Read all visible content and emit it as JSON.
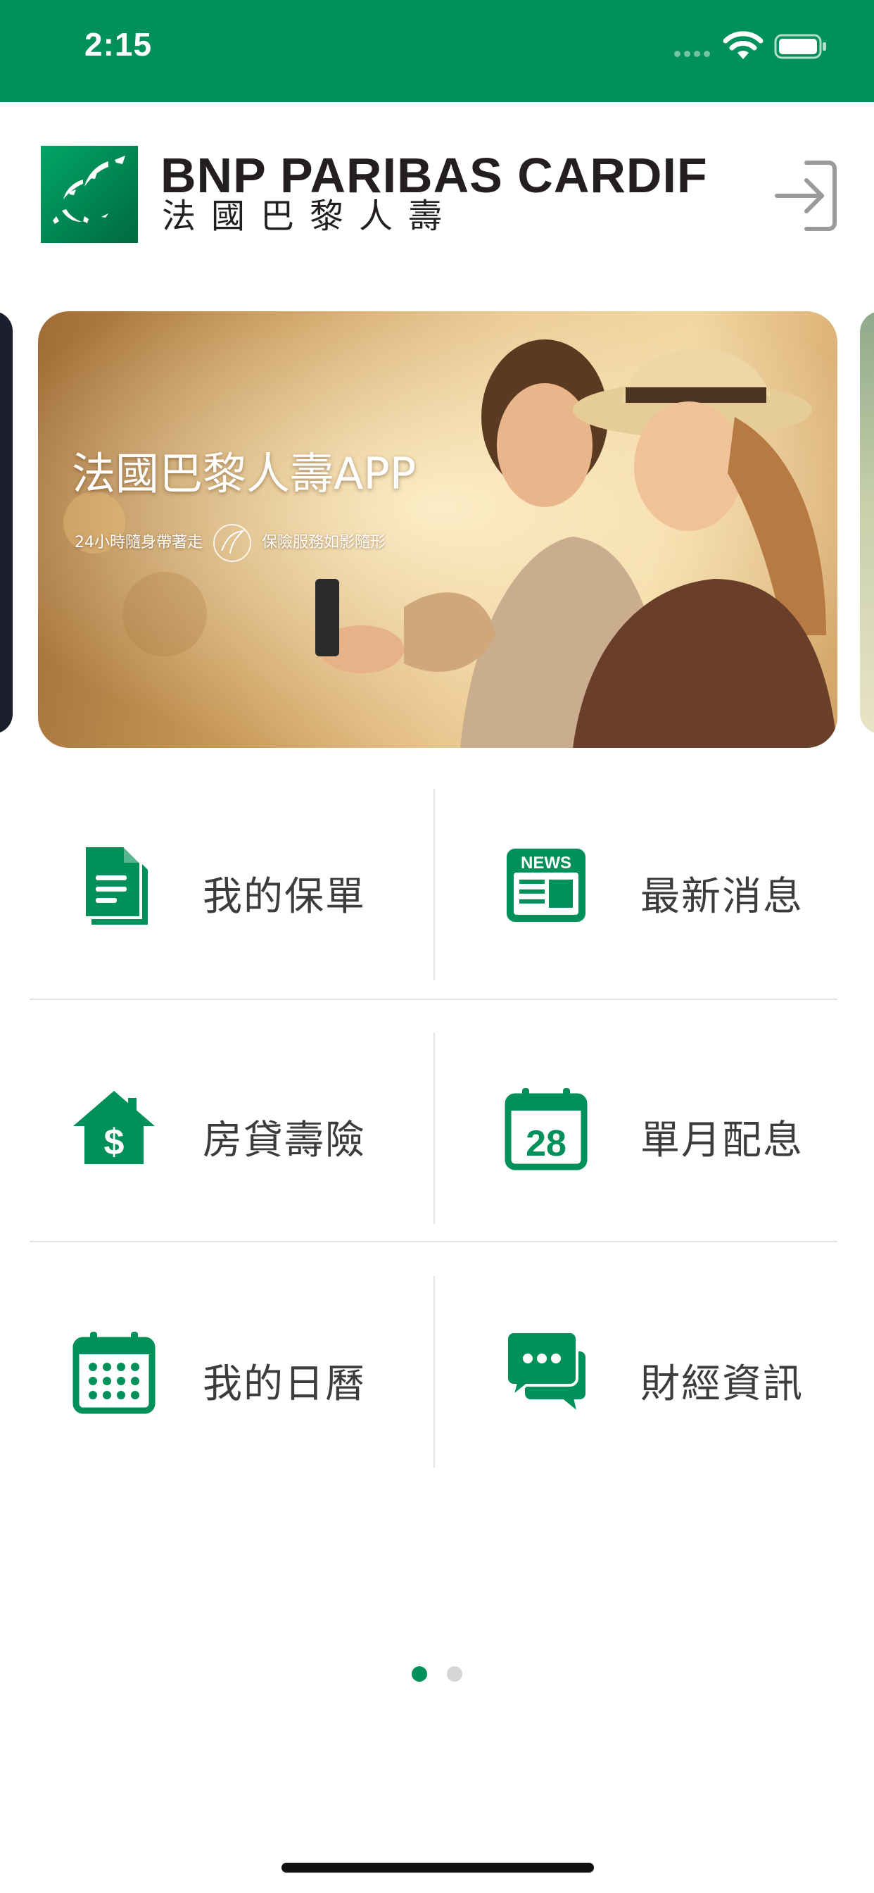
{
  "status_bar": {
    "time": "2:15",
    "background_color": "#00905a"
  },
  "header": {
    "brand_en": "BNP PARIBAS CARDIF",
    "brand_zh": "法國巴黎人壽",
    "login_icon": "login-arrow-icon"
  },
  "banner": {
    "title": "法國巴黎人壽APP",
    "subtitle_left": "24小時隨身帶著走",
    "subtitle_right": "保險服務如影隨形",
    "active_page": 1,
    "page_count": 2
  },
  "menu": {
    "items": [
      {
        "label": "我的保單",
        "icon": "document-icon"
      },
      {
        "label": "最新消息",
        "icon": "news-icon",
        "icon_text": "NEWS"
      },
      {
        "label": "房貸壽險",
        "icon": "house-dollar-icon",
        "icon_text": "$"
      },
      {
        "label": "單月配息",
        "icon": "calendar-28-icon",
        "icon_text": "28"
      },
      {
        "label": "我的日曆",
        "icon": "calendar-grid-icon"
      },
      {
        "label": "財經資訊",
        "icon": "chat-bubbles-icon"
      }
    ]
  },
  "theme": {
    "accent": "#00905a",
    "text": "#3c3c3c",
    "divider": "#e2e2e2"
  }
}
